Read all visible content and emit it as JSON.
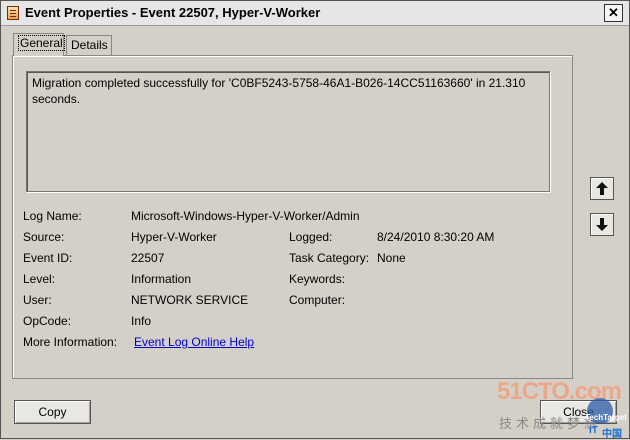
{
  "window": {
    "title": "Event Properties - Event 22507, Hyper-V-Worker",
    "close_glyph": "✕"
  },
  "tabs": [
    {
      "label": "General"
    },
    {
      "label": "Details"
    }
  ],
  "message": "Migration completed successfully for 'C0BF5243-5758-46A1-B026-14CC51163660' in 21.310 seconds.",
  "fields": {
    "log_name": {
      "label": "Log Name:",
      "value": "Microsoft-Windows-Hyper-V-Worker/Admin"
    },
    "source": {
      "label": "Source:",
      "value": "Hyper-V-Worker"
    },
    "logged": {
      "label": "Logged:",
      "value": "8/24/2010 8:30:20 AM"
    },
    "event_id": {
      "label": "Event ID:",
      "value": "22507"
    },
    "task_category": {
      "label": "Task Category:",
      "value": "None"
    },
    "level": {
      "label": "Level:",
      "value": "Information"
    },
    "keywords": {
      "label": "Keywords:",
      "value": ""
    },
    "user": {
      "label": "User:",
      "value": "NETWORK SERVICE"
    },
    "computer": {
      "label": "Computer:",
      "value": ""
    },
    "opcode": {
      "label": "OpCode:",
      "value": "Info"
    },
    "more_info": {
      "label": "More Information:",
      "value": "Event Log Online Help"
    }
  },
  "buttons": {
    "copy": "Copy",
    "close": "Close"
  },
  "watermark": {
    "site": "51CTO.com",
    "chinese": "技术成就梦想",
    "brand": "TechTarget",
    "brand_sub": "中国",
    "brand2": "IT"
  }
}
